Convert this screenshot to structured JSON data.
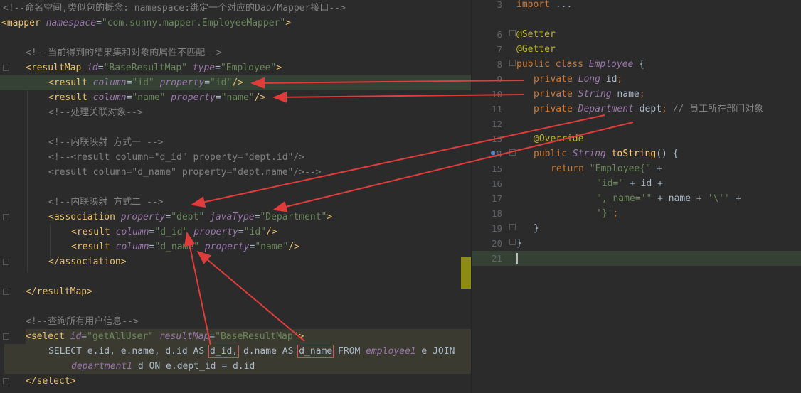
{
  "left_editor": {
    "lines": [
      {
        "id": "l1",
        "parts": [
          [
            "cm",
            "<!--命名空间,类似包的概念: namespace:绑定一个对应的Dao/Mapper接口-->"
          ]
        ]
      },
      {
        "id": "l2",
        "parts": [
          [
            "tag",
            "<mapper "
          ],
          [
            "attr",
            "namespace"
          ],
          [
            "plain",
            "="
          ],
          [
            "str",
            "\"com.sunny.mapper.EmployeeMapper\""
          ],
          [
            "tag",
            ">"
          ]
        ]
      },
      {
        "id": "l3",
        "parts": []
      },
      {
        "id": "l4",
        "parts": [
          [
            "cm",
            "<!--当前得到的结果集和对象的属性不匹配-->"
          ]
        ]
      },
      {
        "id": "l5",
        "parts": [
          [
            "tag",
            "<resultMap "
          ],
          [
            "attr",
            "id"
          ],
          [
            "plain",
            "="
          ],
          [
            "str",
            "\"BaseResultMap\" "
          ],
          [
            "attr",
            "type"
          ],
          [
            "plain",
            "="
          ],
          [
            "str",
            "\"Employee\""
          ],
          [
            "tag",
            ">"
          ]
        ]
      },
      {
        "id": "l6",
        "parts": [
          [
            "tag",
            "<result "
          ],
          [
            "attr",
            "column"
          ],
          [
            "plain",
            "="
          ],
          [
            "str",
            "\"id\" "
          ],
          [
            "attr",
            "property"
          ],
          [
            "plain",
            "="
          ],
          [
            "str",
            "\"id\""
          ],
          [
            "tag",
            "/>"
          ]
        ]
      },
      {
        "id": "l7",
        "parts": [
          [
            "tag",
            "<result "
          ],
          [
            "attr",
            "column"
          ],
          [
            "plain",
            "="
          ],
          [
            "str",
            "\"name\" "
          ],
          [
            "attr",
            "property"
          ],
          [
            "plain",
            "="
          ],
          [
            "str",
            "\"name\""
          ],
          [
            "tag",
            "/>"
          ]
        ]
      },
      {
        "id": "l8",
        "parts": [
          [
            "cm",
            "<!--处理关联对象-->"
          ]
        ]
      },
      {
        "id": "l9",
        "parts": []
      },
      {
        "id": "l10",
        "parts": [
          [
            "cm",
            "<!--内联映射 方式一 -->"
          ]
        ]
      },
      {
        "id": "l11",
        "parts": [
          [
            "cm",
            "<!--<result column=\"d_id\" property=\"dept.id\"/>"
          ]
        ]
      },
      {
        "id": "l12",
        "parts": [
          [
            "cm",
            "<result column=\"d_name\" property=\"dept.name\"/>-->"
          ]
        ]
      },
      {
        "id": "l13",
        "parts": []
      },
      {
        "id": "l14",
        "parts": [
          [
            "cm",
            "<!--内联映射 方式二 -->"
          ]
        ]
      },
      {
        "id": "l15",
        "parts": [
          [
            "tag",
            "<association "
          ],
          [
            "attr",
            "property"
          ],
          [
            "plain",
            "="
          ],
          [
            "str",
            "\"dept\" "
          ],
          [
            "attr",
            "javaType"
          ],
          [
            "plain",
            "="
          ],
          [
            "str",
            "\"Department\""
          ],
          [
            "tag",
            ">"
          ]
        ]
      },
      {
        "id": "l16",
        "parts": [
          [
            "tag",
            "<result "
          ],
          [
            "attr",
            "column"
          ],
          [
            "plain",
            "="
          ],
          [
            "str",
            "\"d_id\" "
          ],
          [
            "attr",
            "property"
          ],
          [
            "plain",
            "="
          ],
          [
            "str",
            "\"id\""
          ],
          [
            "tag",
            "/>"
          ]
        ]
      },
      {
        "id": "l17",
        "parts": [
          [
            "tag",
            "<result "
          ],
          [
            "attr",
            "column"
          ],
          [
            "plain",
            "="
          ],
          [
            "str",
            "\"d_name\" "
          ],
          [
            "attr",
            "property"
          ],
          [
            "plain",
            "="
          ],
          [
            "str",
            "\"name\""
          ],
          [
            "tag",
            "/>"
          ]
        ]
      },
      {
        "id": "l18",
        "parts": [
          [
            "tag",
            "</association>"
          ]
        ]
      },
      {
        "id": "l19",
        "parts": []
      },
      {
        "id": "l20",
        "parts": [
          [
            "tag",
            "</resultMap>"
          ]
        ]
      },
      {
        "id": "l21",
        "parts": []
      },
      {
        "id": "l22",
        "parts": [
          [
            "cm",
            "<!--查询所有用户信息-->"
          ]
        ]
      },
      {
        "id": "l23",
        "parts": [
          [
            "tag",
            "<select "
          ],
          [
            "attr",
            "id"
          ],
          [
            "plain",
            "="
          ],
          [
            "str",
            "\"getAllUser\" "
          ],
          [
            "attr",
            "resultMap"
          ],
          [
            "plain",
            "="
          ],
          [
            "str",
            "\"BaseResultMap\""
          ],
          [
            "tag",
            ">"
          ]
        ]
      },
      {
        "id": "l24",
        "parts": [
          [
            "plain",
            "SELECT e.id, e.name, d.id AS "
          ],
          [
            "box",
            "d_id,"
          ],
          [
            "plain",
            " d.name AS "
          ],
          [
            "box",
            "d_name"
          ],
          [
            "plain",
            " FROM "
          ],
          [
            "cls",
            "employee1"
          ],
          [
            "plain",
            " e JOIN"
          ]
        ]
      },
      {
        "id": "l25",
        "parts": [
          [
            "cls",
            "department1"
          ],
          [
            "plain",
            " d ON e.dept_id = d.id"
          ]
        ]
      },
      {
        "id": "l26",
        "parts": [
          [
            "tag",
            "</select>"
          ]
        ]
      }
    ]
  },
  "right_editor": {
    "lines": [
      {
        "num": "3",
        "parts": [
          [
            "kw",
            "import "
          ],
          [
            "plain",
            "..."
          ]
        ]
      },
      {
        "num": "",
        "parts": []
      },
      {
        "num": "6",
        "parts": [
          [
            "ann",
            "@Setter"
          ]
        ]
      },
      {
        "num": "7",
        "parts": [
          [
            "ann",
            "@Getter"
          ]
        ]
      },
      {
        "num": "8",
        "parts": [
          [
            "kw",
            "public class "
          ],
          [
            "cls",
            "Employee"
          ],
          [
            "plain",
            " {"
          ]
        ]
      },
      {
        "num": "9",
        "parts": [
          [
            "kw",
            "private "
          ],
          [
            "cls",
            "Long"
          ],
          [
            "plain",
            " id"
          ],
          [
            "kw",
            ";"
          ]
        ]
      },
      {
        "num": "10",
        "parts": [
          [
            "kw",
            "private "
          ],
          [
            "cls",
            "String"
          ],
          [
            "plain",
            " name"
          ],
          [
            "kw",
            ";"
          ]
        ]
      },
      {
        "num": "11",
        "parts": [
          [
            "kw",
            "private "
          ],
          [
            "cls",
            "Department"
          ],
          [
            "plain",
            " dept"
          ],
          [
            "kw",
            ";"
          ],
          [
            "cm",
            " // 员工所在部门对象"
          ]
        ]
      },
      {
        "num": "12",
        "parts": []
      },
      {
        "num": "13",
        "parts": [
          [
            "ann",
            "@Override"
          ]
        ]
      },
      {
        "num": "14",
        "parts": [
          [
            "kw",
            "public "
          ],
          [
            "cls",
            "String"
          ],
          [
            "fn",
            " toString"
          ],
          [
            "plain",
            "() {"
          ]
        ]
      },
      {
        "num": "15",
        "parts": [
          [
            "kw",
            "return "
          ],
          [
            "str",
            "\"Employee{\""
          ],
          [
            "plain",
            " +"
          ]
        ]
      },
      {
        "num": "16",
        "parts": [
          [
            "str",
            "\"id=\""
          ],
          [
            "plain",
            " + id +"
          ]
        ]
      },
      {
        "num": "17",
        "parts": [
          [
            "str",
            "\", name='\""
          ],
          [
            "plain",
            " + name + "
          ],
          [
            "str",
            "'\\''"
          ],
          [
            "plain",
            " +"
          ]
        ]
      },
      {
        "num": "18",
        "parts": [
          [
            "str",
            "'}'"
          ],
          [
            "kw",
            ";"
          ]
        ]
      },
      {
        "num": "19",
        "parts": [
          [
            "plain",
            "}"
          ]
        ]
      },
      {
        "num": "20",
        "parts": [
          [
            "plain",
            "}"
          ]
        ]
      },
      {
        "num": "21",
        "parts": []
      }
    ]
  },
  "colors": {
    "background": "#2b2b2b",
    "highlight_line": "#344134",
    "sql_background": "#3a3a30",
    "arrow": "#e03c3c"
  }
}
